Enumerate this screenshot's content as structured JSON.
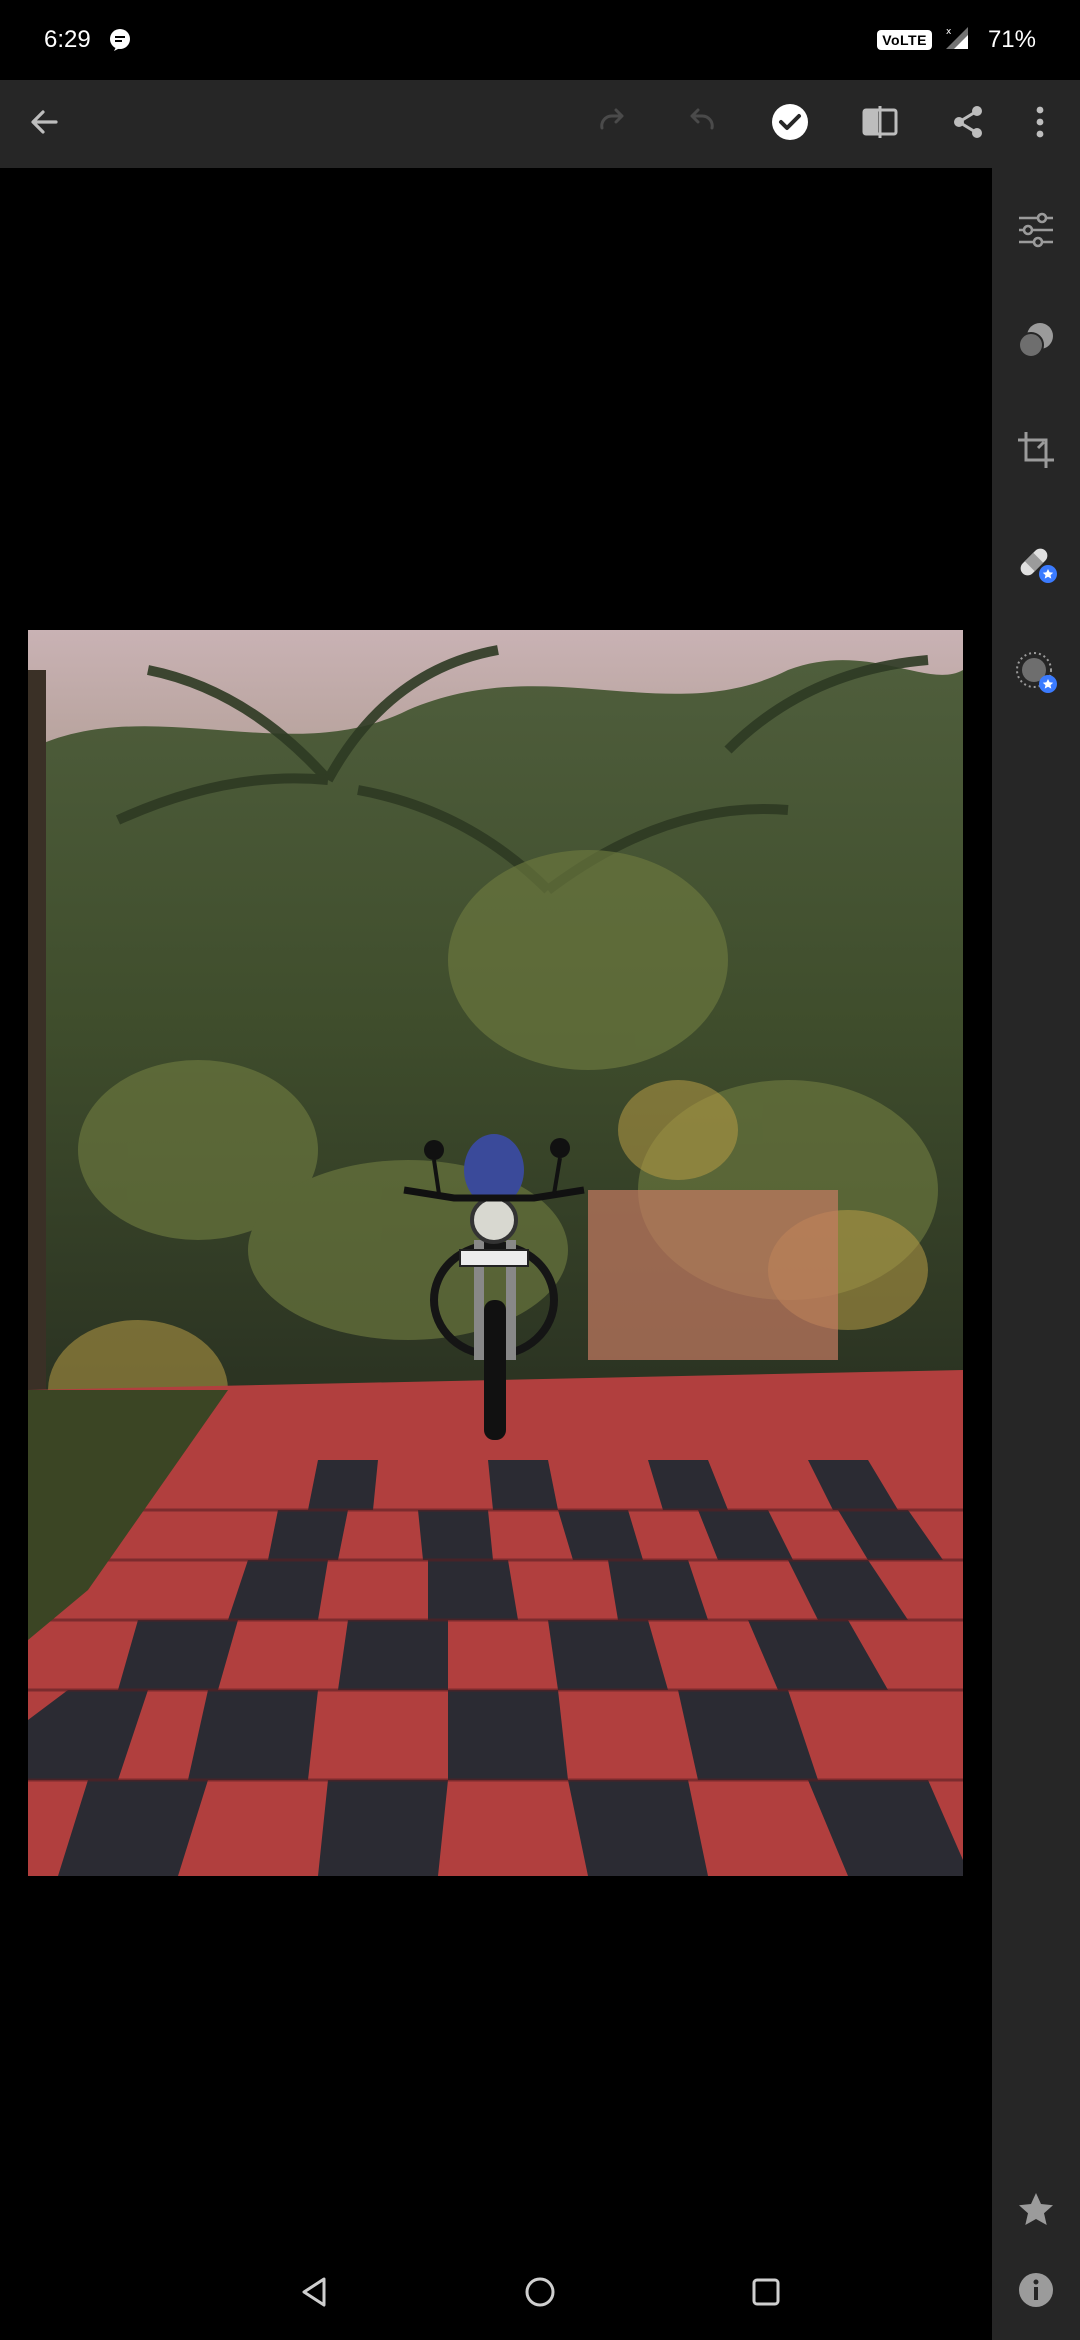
{
  "status_bar": {
    "time": "6:29",
    "network_badge": "VoLTE",
    "battery": "71%"
  },
  "toolbar": {
    "back_icon": "arrow-left-icon",
    "redo_icon": "redo-icon",
    "undo_icon": "undo-icon",
    "done_icon": "check-circle-icon",
    "compare_icon": "compare-icon",
    "share_icon": "share-icon",
    "more_icon": "more-vert-icon"
  },
  "side_panel": {
    "items": [
      {
        "icon": "sliders-icon"
      },
      {
        "icon": "presets-icon"
      },
      {
        "icon": "crop-icon"
      },
      {
        "icon": "healing-icon",
        "premium": true
      },
      {
        "icon": "selective-icon",
        "premium": true
      },
      {
        "icon": "star-icon"
      },
      {
        "icon": "info-icon"
      }
    ]
  },
  "photo": {
    "subject": "motorcycle on checkered tiles"
  },
  "nav": {
    "back_icon": "nav-back-icon",
    "home_icon": "nav-home-icon",
    "recents_icon": "nav-recents-icon"
  },
  "colors": {
    "toolbar_bg": "#262626",
    "accent_badge": "#3b7bff",
    "icon_gray": "#9b9b9b"
  }
}
